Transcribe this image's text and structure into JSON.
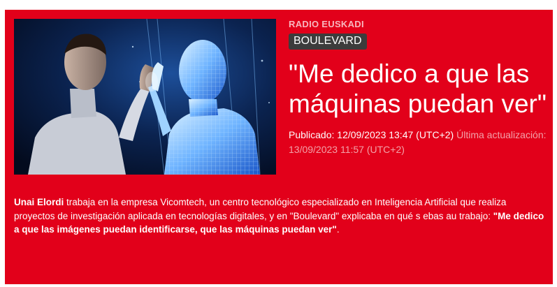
{
  "article": {
    "source": "RADIO EUSKADI",
    "program": "BOULEVARD",
    "headline": "\"Me dedico a que las máquinas puedan ver\"",
    "published_label": "Publicado:",
    "published_value": "12/09/2023 13:47 (UTC+2)",
    "updated_label": "Última actualización:",
    "updated_value": "13/09/2023 11:57 (UTC+2)",
    "body": {
      "person": "Unai Elordi",
      "text": " trabaja en la empresa Vicomtech, un centro tecnológico especializado en Inteligencia Artificial que realiza proyectos de investigación aplicada en tecnologías digitales, y en \"Boulevard\" explicaba en qué s ebas au trabajo: ",
      "quote": "\"Me dedico a que las imágenes puedan identificarse, que las máquinas puedan ver\"",
      "end": "."
    }
  },
  "colors": {
    "background": "#e2001a",
    "badge": "#3c3c3c",
    "text": "#ffffff"
  },
  "thumbnail": {
    "icon": "man-and-digital-hologram-illustration"
  }
}
